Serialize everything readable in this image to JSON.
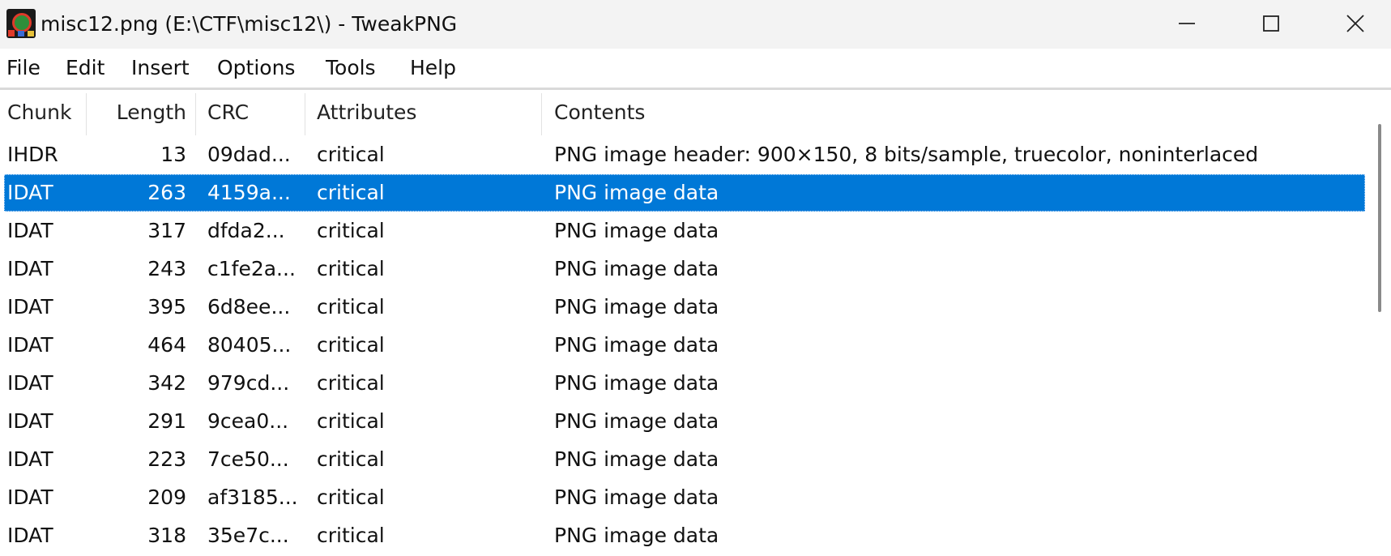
{
  "window": {
    "title": "misc12.png (E:\\CTF\\misc12\\) - TweakPNG",
    "app_icon": "tweakpng-app-icon",
    "controls": [
      "minimize-icon",
      "maximize-icon",
      "close-icon"
    ]
  },
  "menu": {
    "items": [
      "File",
      "Edit",
      "Insert",
      "Options",
      "Tools",
      "Help"
    ]
  },
  "columns": [
    "Chunk",
    "Length",
    "CRC",
    "Attributes",
    "Contents"
  ],
  "rows": [
    {
      "chunk": "IHDR",
      "length": "13",
      "crc": "09dad...",
      "attributes": "critical",
      "contents": "PNG image header: 900×150, 8 bits/sample, truecolor, noninterlaced"
    },
    {
      "chunk": "IDAT",
      "length": "263",
      "crc": "4159a...",
      "attributes": "critical",
      "contents": "PNG image data"
    },
    {
      "chunk": "IDAT",
      "length": "317",
      "crc": "dfda2...",
      "attributes": "critical",
      "contents": "PNG image data"
    },
    {
      "chunk": "IDAT",
      "length": "243",
      "crc": "c1fe2a...",
      "attributes": "critical",
      "contents": "PNG image data"
    },
    {
      "chunk": "IDAT",
      "length": "395",
      "crc": "6d8ee...",
      "attributes": "critical",
      "contents": "PNG image data"
    },
    {
      "chunk": "IDAT",
      "length": "464",
      "crc": "80405...",
      "attributes": "critical",
      "contents": "PNG image data"
    },
    {
      "chunk": "IDAT",
      "length": "342",
      "crc": "979cd...",
      "attributes": "critical",
      "contents": "PNG image data"
    },
    {
      "chunk": "IDAT",
      "length": "291",
      "crc": "9cea0...",
      "attributes": "critical",
      "contents": "PNG image data"
    },
    {
      "chunk": "IDAT",
      "length": "223",
      "crc": "7ce50...",
      "attributes": "critical",
      "contents": "PNG image data"
    },
    {
      "chunk": "IDAT",
      "length": "209",
      "crc": "af3185...",
      "attributes": "critical",
      "contents": "PNG image data"
    },
    {
      "chunk": "IDAT",
      "length": "318",
      "crc": "35e7c...",
      "attributes": "critical",
      "contents": "PNG image data"
    }
  ],
  "selected_row": 1,
  "colors": {
    "selection": "#0078d7",
    "titlebar": "#f3f3f3"
  }
}
